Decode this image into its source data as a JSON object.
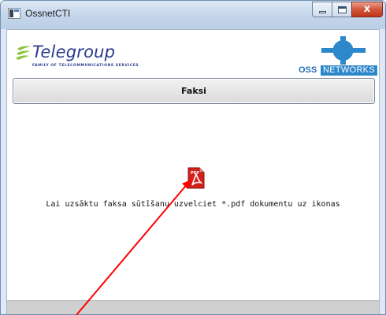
{
  "window": {
    "title": "OssnetCTI",
    "close_glyph": "x"
  },
  "header": {
    "telegroup_logo": {
      "name": "Telegroup",
      "tagline": "FAMILY OF TELECOMMUNICATIONS SERVICES"
    },
    "ossnetworks_logo": {
      "oss": "OSS",
      "networks": "NETWORKS"
    }
  },
  "main": {
    "fax_button_label": "Faksi",
    "drop_icon": "pdf-icon",
    "instruction": "Lai uzsāktu faksa sūtīšanu uzvelciet *.pdf dokumentu uz ikonas"
  },
  "colors": {
    "arrow": "#ff0000",
    "telegroup_blue": "#2a3a8c",
    "telegroup_green": "#8cc63f",
    "oss_blue": "#2d87cb",
    "pdf_red": "#d4201b",
    "close_button": "#c8482c"
  }
}
